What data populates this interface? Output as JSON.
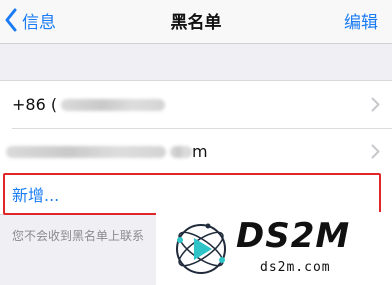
{
  "nav": {
    "back_label": "信息",
    "title": "黑名单",
    "edit_label": "编辑"
  },
  "list": {
    "items": [
      {
        "prefix": "+86 (",
        "suffix": ""
      },
      {
        "prefix": "",
        "suffix": "m"
      }
    ]
  },
  "add_label": "新增...",
  "footnote": "您不会收到黑名单上联系",
  "watermark": {
    "brand": "DS2M",
    "url": "ds2m.com"
  },
  "colors": {
    "accent": "#1a7cf5",
    "highlight_border": "#e0262b",
    "background": "#efeff4"
  },
  "icons": [
    "chevron-left-icon",
    "chevron-right-icon",
    "ds2m-logo"
  ]
}
